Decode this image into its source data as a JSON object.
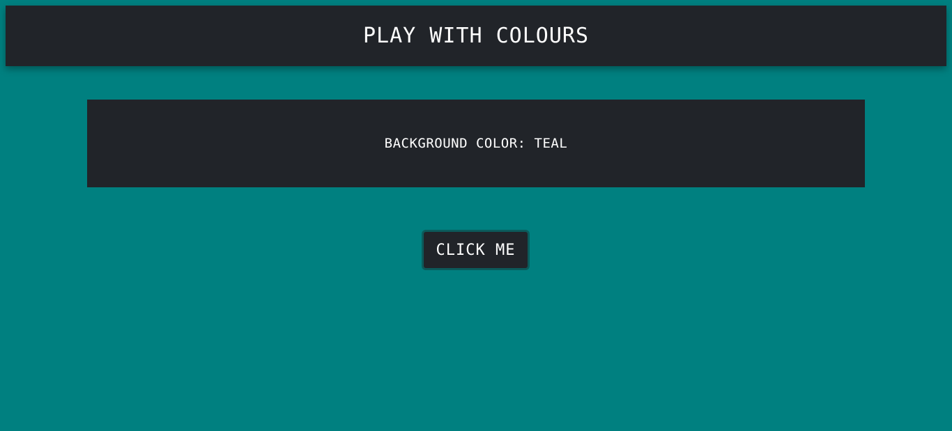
{
  "header": {
    "title": "PLAY WITH COLOURS"
  },
  "info": {
    "text": "BACKGROUND COLOR: TEAL"
  },
  "button": {
    "label": "CLICK ME"
  },
  "colors": {
    "background": "#008080",
    "panel": "#212429",
    "button_border": "#0b5b5b",
    "text": "#ffffff"
  }
}
